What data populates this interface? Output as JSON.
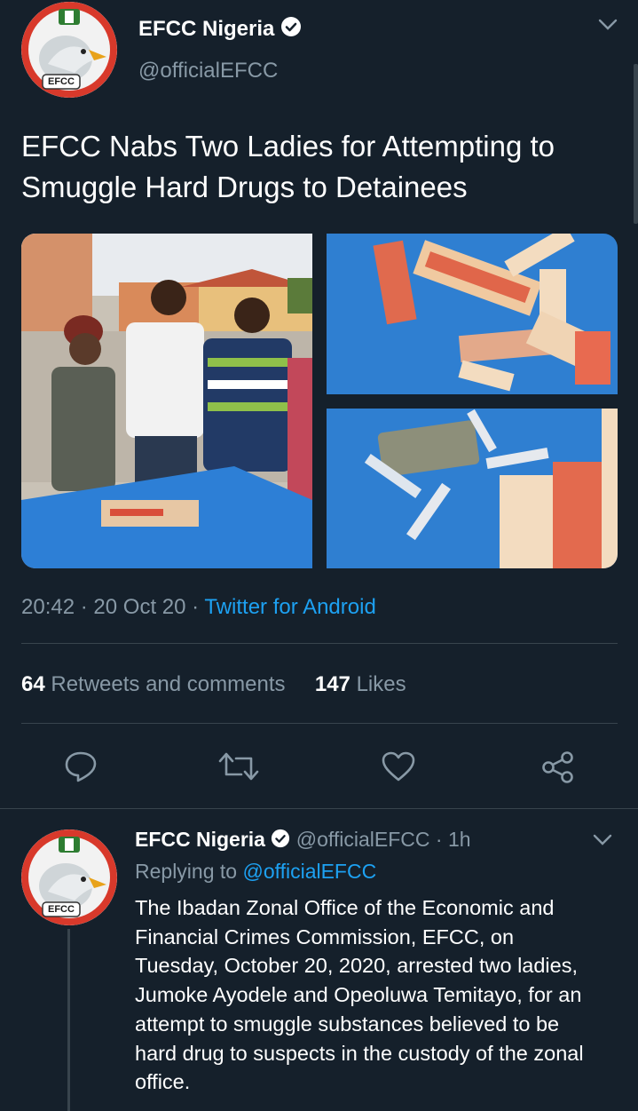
{
  "main_tweet": {
    "author_name": "EFCC Nigeria",
    "author_handle": "@officialEFCC",
    "avatar_badge": "EFCC",
    "text_line1": "EFCC Nabs Two Ladies for Attempting to",
    "text_line2": "Smuggle Hard Drugs to Detainees",
    "time": "20:42",
    "date": "20 Oct 20",
    "source": "Twitter for Android",
    "retweets_count": "64",
    "retweets_label": "Retweets and comments",
    "likes_count": "147",
    "likes_label": "Likes"
  },
  "actions": {
    "reply_icon": "reply-icon",
    "retweet_icon": "retweet-icon",
    "like_icon": "heart-icon",
    "share_icon": "share-icon"
  },
  "reply_tweet": {
    "author_name": "EFCC Nigeria",
    "author_handle": "@officialEFCC",
    "age": "1h",
    "replying_label": "Replying to",
    "replying_handle": "@officialEFCC",
    "avatar_badge": "EFCC",
    "text_lines": [
      "The Ibadan Zonal Office of the Economic and",
      "Financial Crimes Commission, EFCC, on",
      "Tuesday, October 20, 2020, arrested two ladies,",
      "Jumoke Ayodele and Opeoluwa Temitayo, for an",
      "attempt to smuggle substances believed to be",
      "hard drug to suspects in the custody of the zonal",
      "office."
    ]
  },
  "colors": {
    "background": "#15202b",
    "muted": "#8899a6",
    "accent": "#1da1f2",
    "divider": "#38444d"
  }
}
